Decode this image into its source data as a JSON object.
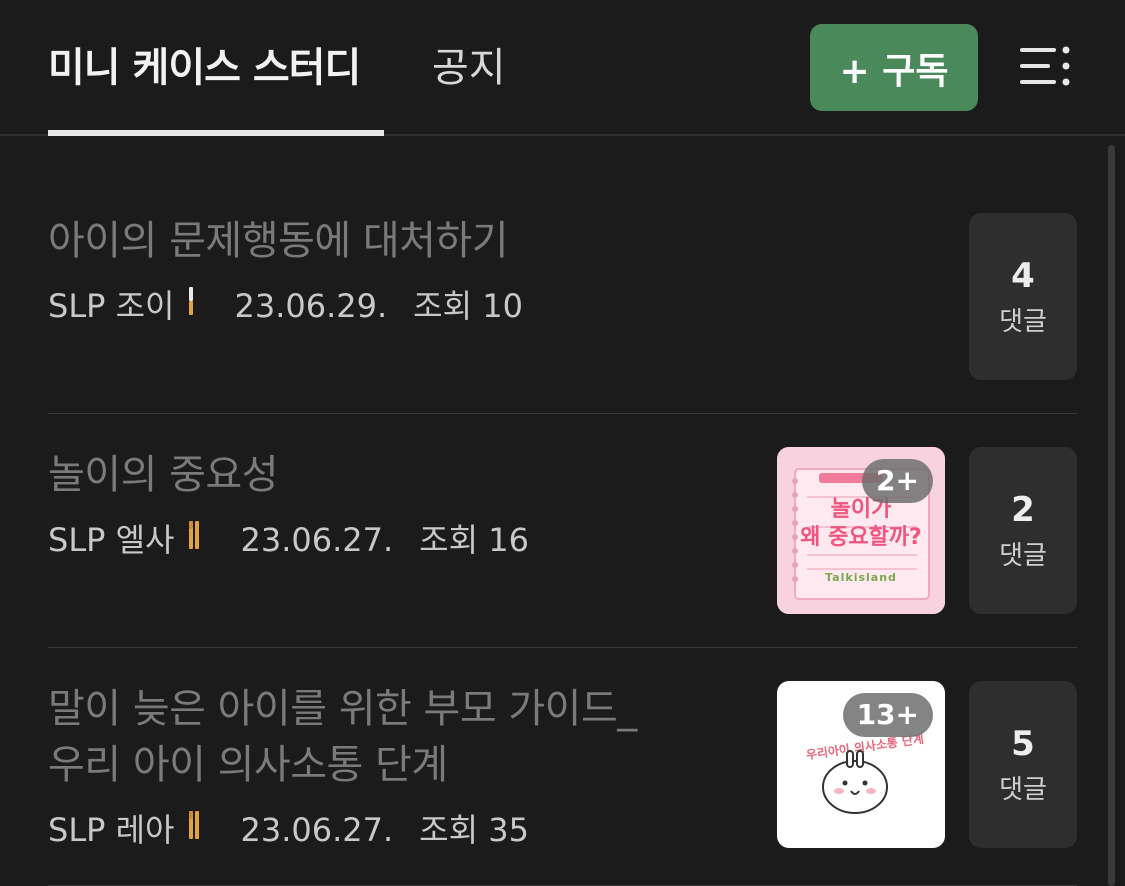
{
  "header": {
    "tab_active": "미니 케이스 스터디",
    "tab_notice": "공지",
    "subscribe_label": "+ 구독"
  },
  "posts": [
    {
      "title": "아이의 문제행동에 대처하기",
      "author": "SLP 조이",
      "date": "23.06.29.",
      "views": "조회 10",
      "comment_count": "4",
      "comment_label": "댓글"
    },
    {
      "title": "놀이의 중요성",
      "author": "SLP 엘사",
      "date": "23.06.27.",
      "views": "조회 16",
      "thumb_count": "2+",
      "thumb_text_top": "놀이가",
      "thumb_text_bottom": "왜 중요할까?",
      "thumb_brand": "Talkisland",
      "comment_count": "2",
      "comment_label": "댓글"
    },
    {
      "title_line1": "말이 늦은 아이를 위한 부모 가이드_",
      "title_line2": "우리 아이 의사소통 단계",
      "author": "SLP 레아",
      "date": "23.06.27.",
      "views": "조회 35",
      "thumb_count": "13+",
      "thumb_arc_text": "우리아이 의사소통 단계",
      "comment_count": "5",
      "comment_label": "댓글"
    }
  ],
  "colors": {
    "background": "#1b1b1b",
    "subscribe": "#4a8a5a",
    "badge": "#e3a23a"
  }
}
